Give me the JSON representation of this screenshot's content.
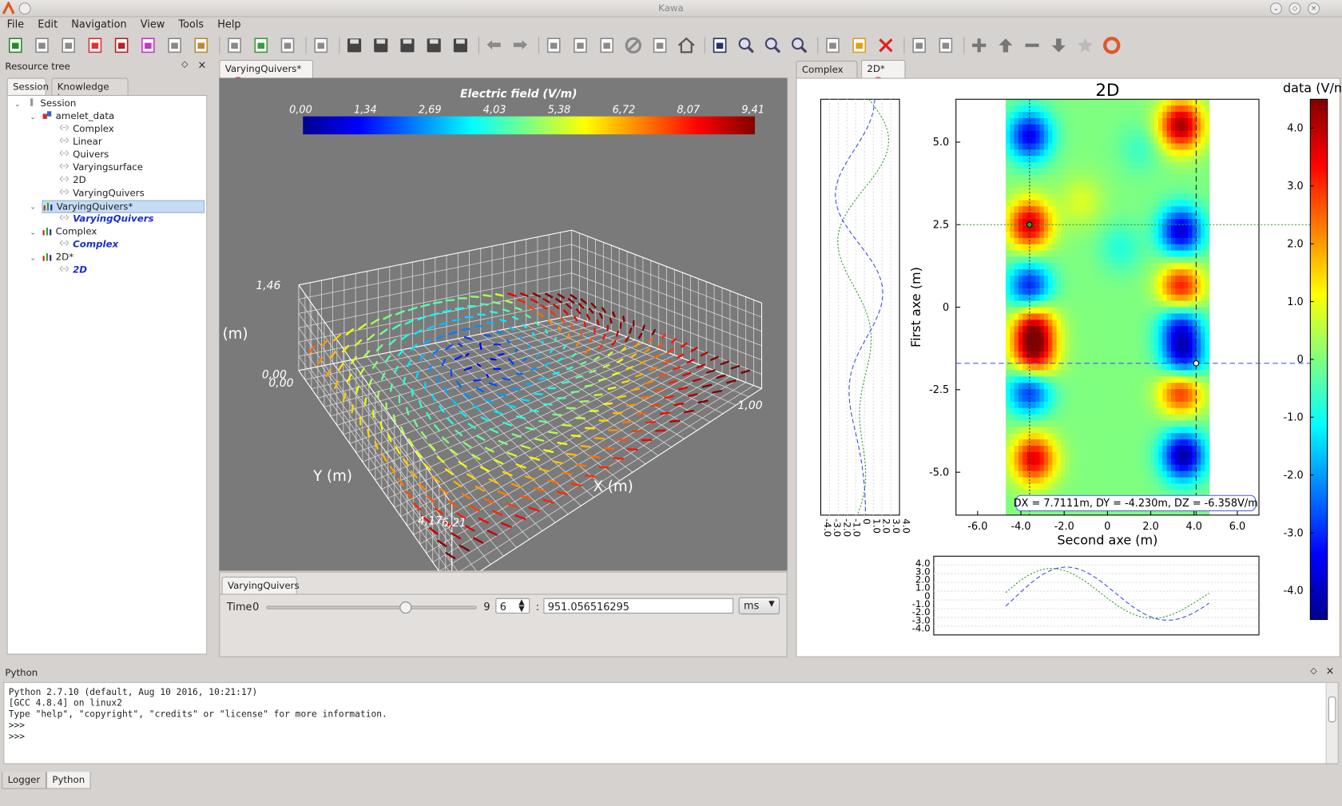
{
  "window": {
    "title": "Kawa"
  },
  "menu": [
    "File",
    "Edit",
    "Navigation",
    "View",
    "Tools",
    "Help"
  ],
  "resource_tree": {
    "title": "Resource tree",
    "tabs": [
      "Session",
      "Knowledge base"
    ],
    "items": [
      {
        "label": "Session",
        "depth": 0,
        "style": "normal",
        "icon": "session-icon"
      },
      {
        "label": "amelet_data",
        "depth": 1,
        "style": "normal",
        "icon": "data-icon"
      },
      {
        "label": "Complex",
        "depth": 2,
        "style": "normal",
        "icon": "link-icon"
      },
      {
        "label": "Linear",
        "depth": 2,
        "style": "normal",
        "icon": "link-icon"
      },
      {
        "label": "Quivers",
        "depth": 2,
        "style": "normal",
        "icon": "link-icon"
      },
      {
        "label": "Varyingsurface",
        "depth": 2,
        "style": "normal",
        "icon": "link-icon"
      },
      {
        "label": "2D",
        "depth": 2,
        "style": "normal",
        "icon": "link-icon"
      },
      {
        "label": "VaryingQuivers",
        "depth": 2,
        "style": "normal",
        "icon": "link-icon"
      },
      {
        "label": "VaryingQuivers*",
        "depth": 1,
        "style": "selected",
        "icon": "chart-icon"
      },
      {
        "label": "VaryingQuivers",
        "depth": 2,
        "style": "italic",
        "icon": "link-icon"
      },
      {
        "label": "Complex",
        "depth": 1,
        "style": "normal",
        "icon": "chart-icon"
      },
      {
        "label": "Complex",
        "depth": 2,
        "style": "italic",
        "icon": "link-icon"
      },
      {
        "label": "2D*",
        "depth": 1,
        "style": "normal",
        "icon": "chart-icon"
      },
      {
        "label": "2D",
        "depth": 2,
        "style": "italic",
        "icon": "link-icon"
      }
    ]
  },
  "center": {
    "tab_label": "VaryingQuivers*",
    "colorbar": {
      "title": "Electric field (V/m)",
      "ticks": [
        "0,00",
        "1,34",
        "2,69",
        "4,03",
        "5,38",
        "6,72",
        "8,07",
        "9,41"
      ]
    },
    "axes": {
      "z_label": "(m)",
      "y_label": "Y (m)",
      "x_label": "X (m)",
      "z_max": "1,46",
      "z_zero": "0,00",
      "y_zero": "0,00",
      "x_max": "1,00",
      "y_max": "4,17",
      "x_min": "6,21"
    },
    "controls": {
      "tab_label": "VaryingQuivers",
      "time_label": "Time",
      "slider_min": "0",
      "slider_max": "9",
      "slider_position": 0.66,
      "step_value": "6",
      "colon": ":",
      "time_value": "951.056516295",
      "unit": "ms"
    }
  },
  "right": {
    "tabs": [
      "Complex",
      "2D*"
    ],
    "chart_data": {
      "type": "heatmap",
      "title": "2D",
      "xlabel": "Second axe (m)",
      "ylabel": "First axe (m)",
      "colorbar_label": "data (V/m)",
      "xticks": [
        "-6.0",
        "-4.0",
        "-2.0",
        "0",
        "2.0",
        "4.0",
        "6.0"
      ],
      "yticks": [
        "5.0",
        "2.5",
        "0",
        "-2.5",
        "-5.0"
      ],
      "colorbar_ticks": [
        "4.0",
        "3.0",
        "2.0",
        "1.0",
        "0",
        "-1.0",
        "-2.0",
        "-3.0",
        "-4.0"
      ],
      "side_ticks": [
        "4.0",
        "3.0",
        "2.0",
        "1.0",
        "0",
        "-1.0",
        "-2.0",
        "-3.0",
        "-4.0"
      ],
      "xlim": [
        -7.0,
        7.0
      ],
      "ylim": [
        -6.3,
        6.3
      ],
      "cursor1": {
        "x": -3.6,
        "y": 2.5
      },
      "cursor2": {
        "x": 4.1,
        "y": -1.7
      },
      "readout": "DX = 7.7111m, DY = -4.230m, DZ = -6.358V/m"
    }
  },
  "python_console": {
    "title": "Python",
    "lines": [
      "Python 2.7.10 (default, Aug 10 2016, 10:21:17)",
      "[GCC 4.8.4] on linux2",
      "Type \"help\", \"copyright\", \"credits\" or \"license\" for more information.",
      ">>>",
      ">>>"
    ]
  },
  "bottom_tabs": [
    "Logger",
    "Python"
  ],
  "colors": {
    "accent_blue": "#1b2fd0",
    "close_red": "#dd3333",
    "panel_gray": "#7a7a7a"
  }
}
